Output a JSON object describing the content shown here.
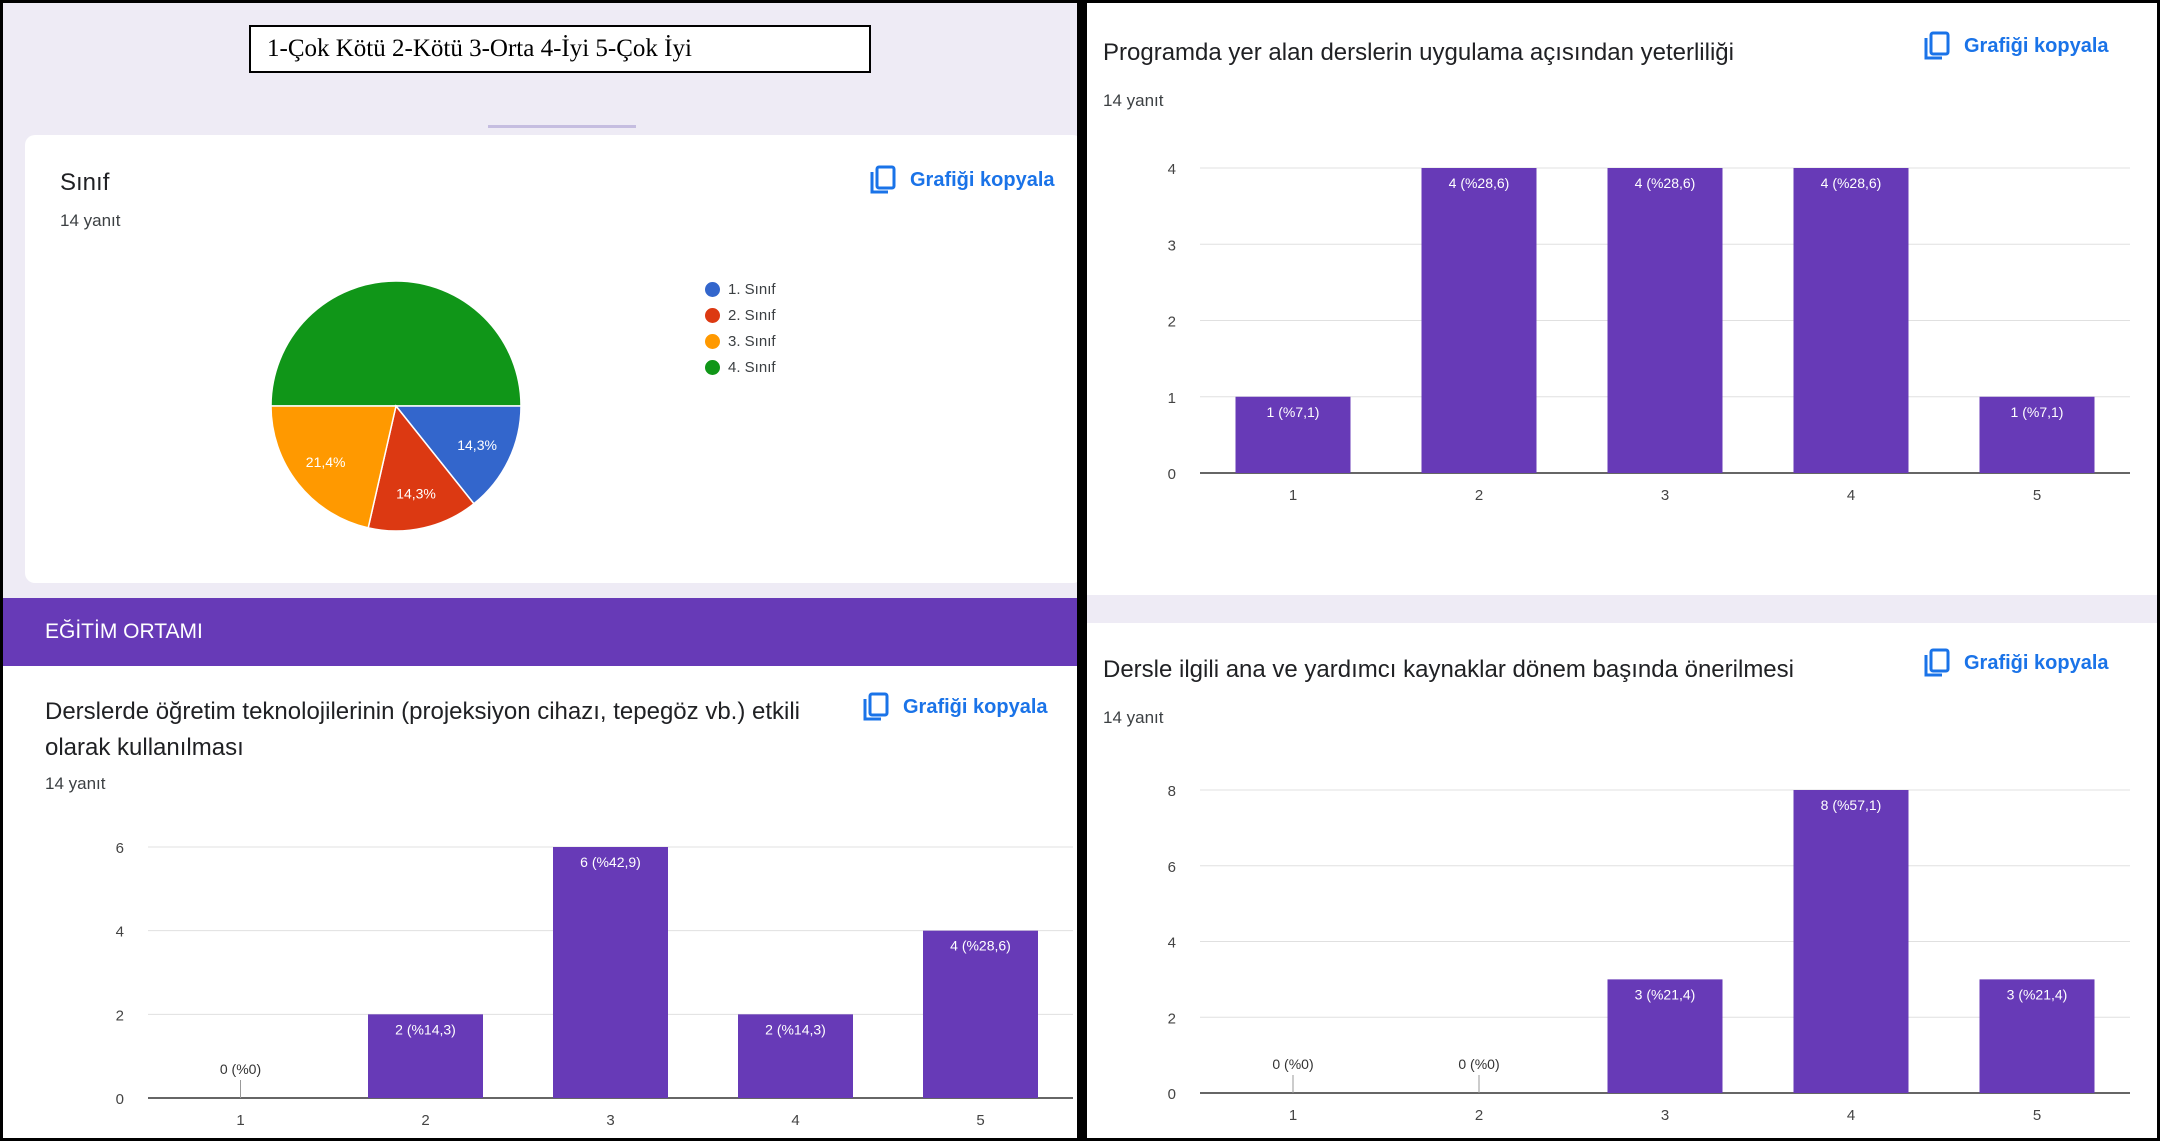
{
  "legend_scale": "1-Çok Kötü 2-Kötü 3-Orta 4-İyi 5-Çok İyi",
  "copy_label": "Grafiği kopyala",
  "section_title": "EĞİTİM ORTAMI",
  "colors": {
    "bar": "#673ab7",
    "link": "#1a73e8",
    "section": "#673ab7"
  },
  "icons": [
    "copy-icon"
  ],
  "charts": {
    "pie": {
      "title": "Sınıf",
      "responses": "14 yanıt"
    },
    "left_bar": {
      "title_line1": "Derslerde öğretim teknolojilerinin (projeksiyon cihazı, tepegöz vb.) etkili",
      "title_line2": "olarak kullanılması",
      "responses": "14 yanıt"
    },
    "right_top": {
      "title": "Programda yer alan derslerin uygulama açısından yeterliliği",
      "responses": "14 yanıt"
    },
    "right_bottom": {
      "title": "Dersle ilgili ana ve yardımcı kaynaklar dönem başında önerilmesi",
      "responses": "14 yanıt"
    }
  },
  "chart_data": [
    {
      "type": "pie",
      "title": "Sınıf",
      "categories": [
        "1. Sınıf",
        "2. Sınıf",
        "3. Sınıf",
        "4. Sınıf"
      ],
      "values": [
        2,
        2,
        3,
        7
      ],
      "labels": [
        "14,3%",
        "14,3%",
        "21,4%",
        "50%"
      ],
      "colors": [
        "#3366cc",
        "#dc3912",
        "#ff9900",
        "#109618"
      ],
      "legend": "right"
    },
    {
      "type": "bar",
      "title": "Derslerde öğretim teknolojilerinin (projeksiyon cihazı, tepegöz vb.) etkili olarak kullanılması",
      "categories": [
        "1",
        "2",
        "3",
        "4",
        "5"
      ],
      "values": [
        0,
        2,
        6,
        2,
        4
      ],
      "labels": [
        "0 (%0)",
        "2 (%14,3)",
        "6 (%42,9)",
        "2 (%14,3)",
        "4 (%28,6)"
      ],
      "yticks": [
        "0",
        "2",
        "4",
        "6"
      ],
      "ylim": [
        0,
        6
      ],
      "grid": true
    },
    {
      "type": "bar",
      "title": "Programda yer alan derslerin uygulama açısından yeterliliği",
      "categories": [
        "1",
        "2",
        "3",
        "4",
        "5"
      ],
      "values": [
        1,
        4,
        4,
        4,
        1
      ],
      "labels": [
        "1 (%7,1)",
        "4 (%28,6)",
        "4 (%28,6)",
        "4 (%28,6)",
        "1 (%7,1)"
      ],
      "yticks": [
        "0",
        "1",
        "2",
        "3",
        "4"
      ],
      "ylim": [
        0,
        4
      ],
      "grid": true
    },
    {
      "type": "bar",
      "title": "Dersle ilgili ana ve yardımcı kaynaklar dönem başında önerilmesi",
      "categories": [
        "1",
        "2",
        "3",
        "4",
        "5"
      ],
      "values": [
        0,
        0,
        3,
        8,
        3
      ],
      "labels": [
        "0 (%0)",
        "0 (%0)",
        "3 (%21,4)",
        "8 (%57,1)",
        "3 (%21,4)"
      ],
      "yticks": [
        "0",
        "2",
        "4",
        "6",
        "8"
      ],
      "ylim": [
        0,
        8
      ],
      "grid": true
    }
  ]
}
